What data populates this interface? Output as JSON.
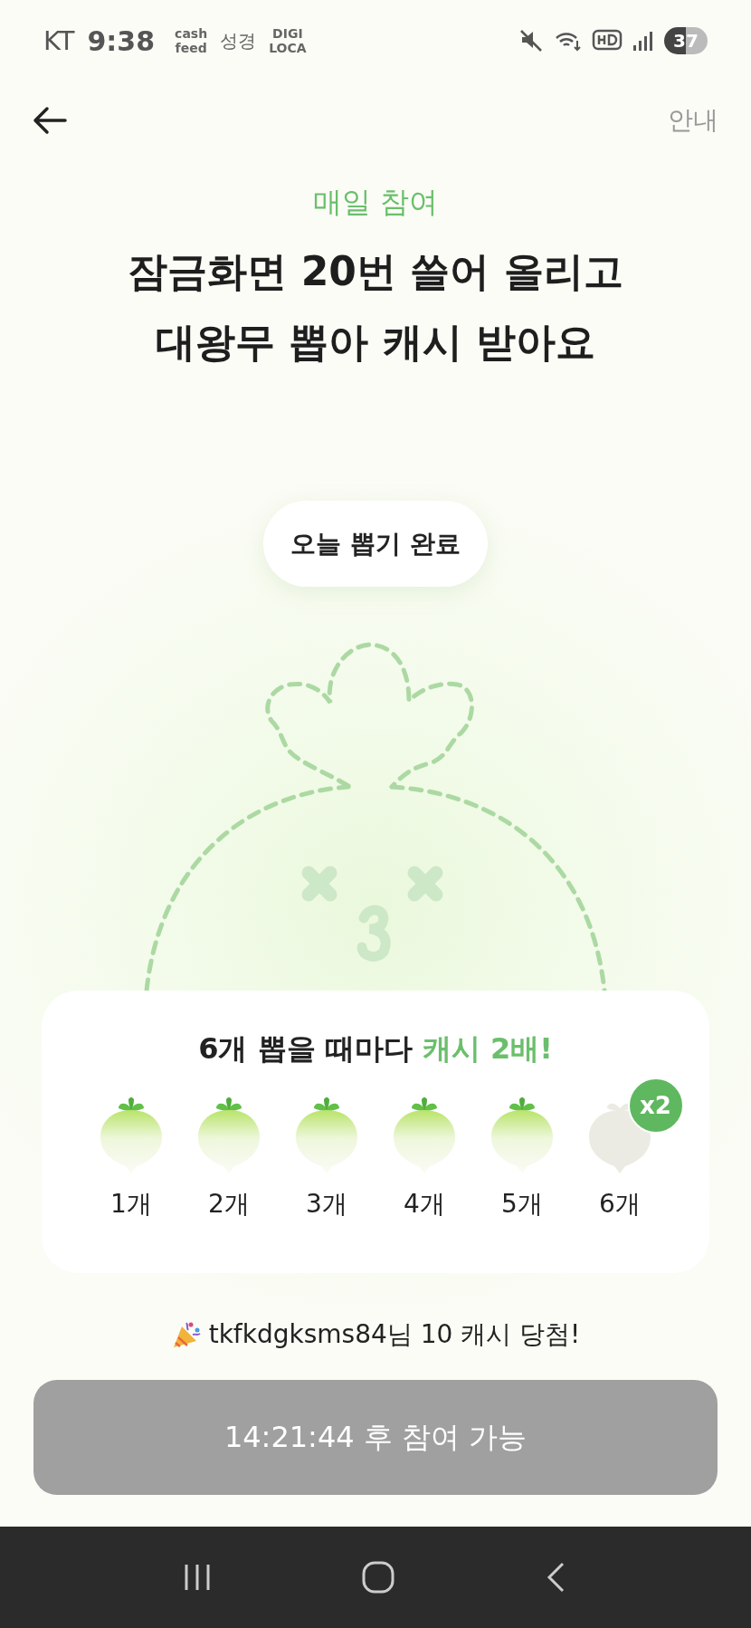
{
  "status_bar": {
    "carrier": "KT",
    "time": "9:38",
    "notifications": [
      "cash feed",
      "성경",
      "DIGI LOCA"
    ],
    "battery": "37"
  },
  "header": {
    "info_link": "안내"
  },
  "eyebrow": "매일 참여",
  "headline": [
    "잠금화면 20번 쓸어 올리고",
    "대왕무 뽑아 캐시 받아요"
  ],
  "status_pill": "오늘 뽑기 완료",
  "reward_card": {
    "title": "6개 뽑을 때마다",
    "title_highlight": "캐시 2배!",
    "items": [
      {
        "label": "1개",
        "collected": true
      },
      {
        "label": "2개",
        "collected": true
      },
      {
        "label": "3개",
        "collected": true
      },
      {
        "label": "4개",
        "collected": true
      },
      {
        "label": "5개",
        "collected": true
      },
      {
        "label": "6개",
        "collected": false,
        "badge": "x2"
      }
    ]
  },
  "ticker": "tkfkdgksms84님 10 캐시 당첨!",
  "cta_button": {
    "label": "14:21:44 후 참여 가능",
    "disabled": true
  }
}
